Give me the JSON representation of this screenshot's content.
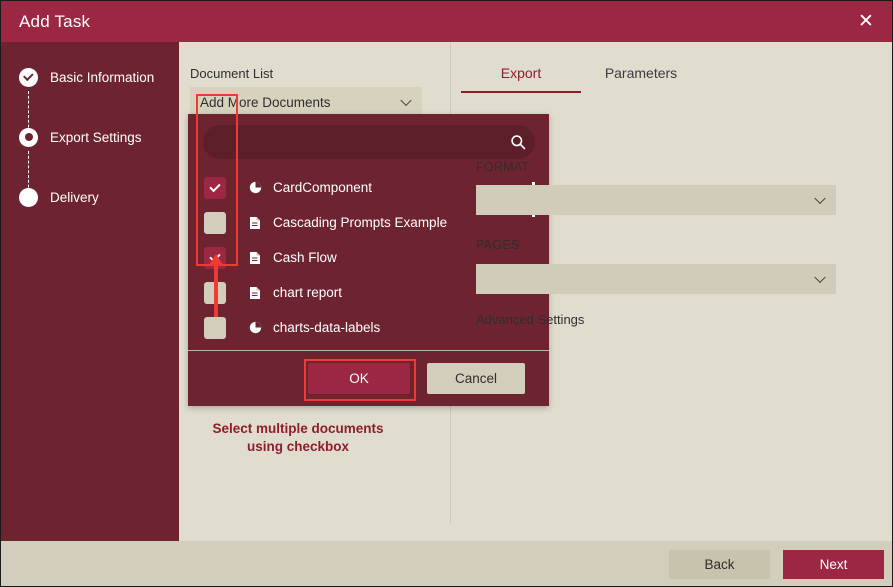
{
  "window": {
    "title": "Add Task",
    "close_icon": "close-icon"
  },
  "sidebar": {
    "steps": [
      {
        "label": "Basic Information",
        "state": "done"
      },
      {
        "label": "Export Settings",
        "state": "current"
      },
      {
        "label": "Delivery",
        "state": "pending"
      }
    ]
  },
  "document_list": {
    "label": "Document List",
    "selected": "Add More Documents",
    "chevron_icon": "chevron-down-icon"
  },
  "dropdown": {
    "search": {
      "value": "",
      "placeholder": "",
      "icon": "search-icon"
    },
    "items": [
      {
        "name": "CardComponent",
        "icon": "pie-chart-icon",
        "checked": true
      },
      {
        "name": "Cascading Prompts Example",
        "icon": "document-icon",
        "checked": false
      },
      {
        "name": "Cash Flow",
        "icon": "document-icon",
        "checked": true
      },
      {
        "name": "chart report",
        "icon": "document-icon",
        "checked": false
      },
      {
        "name": "charts-data-labels",
        "icon": "pie-chart-icon",
        "checked": false
      }
    ],
    "ok_label": "OK",
    "cancel_label": "Cancel"
  },
  "annotation": {
    "line1": "Select multiple documents",
    "line2": "using checkbox",
    "color": "#ee3b33",
    "text_color": "#8f1d2b"
  },
  "panel": {
    "tabs": [
      {
        "label": "Export",
        "active": true
      },
      {
        "label": "Parameters",
        "active": false
      }
    ],
    "format_label": "FORMAT",
    "format_value": "",
    "pages_label": "PAGES",
    "pages_value": "",
    "advanced_link": "Advanced Settings",
    "chevron_icon": "chevron-down-icon"
  },
  "footer": {
    "back_label": "Back",
    "next_label": "Next"
  },
  "colors": {
    "titlebar": "#9b2743",
    "sidebar": "#6e2430",
    "accent": "#9b2743",
    "content_bg": "#e0ddcf",
    "footer_bg": "#d2cebb",
    "annotation": "#ee3b33"
  }
}
